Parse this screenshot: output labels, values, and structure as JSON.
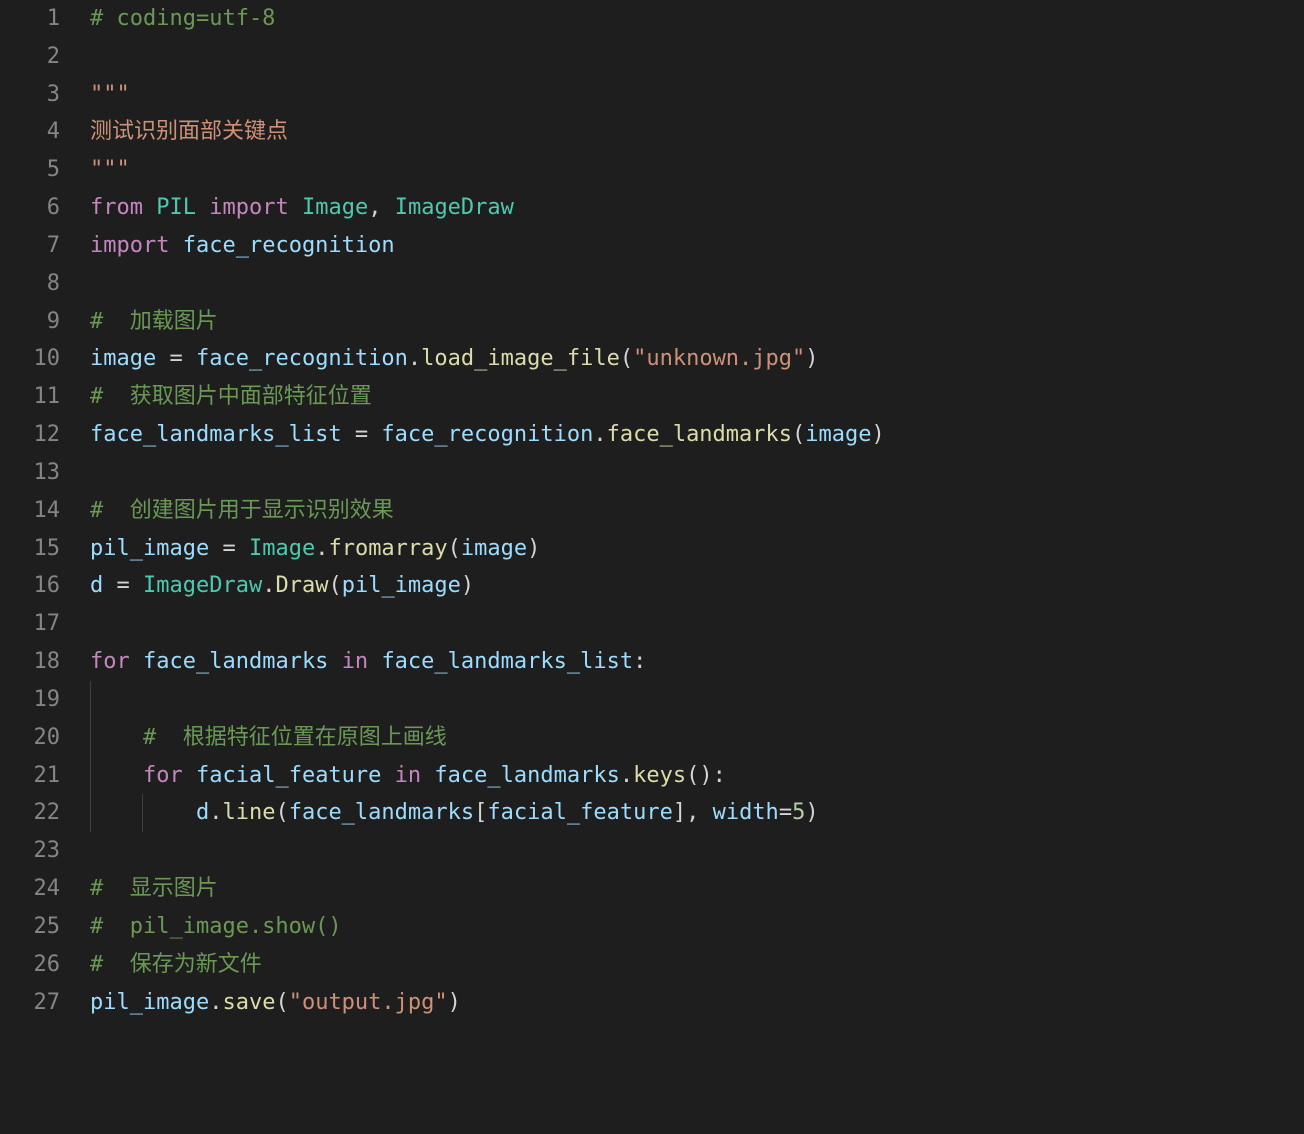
{
  "lines": [
    {
      "num": "1",
      "tokens": [
        {
          "t": "# coding=utf-8",
          "c": "comment"
        }
      ]
    },
    {
      "num": "2",
      "tokens": []
    },
    {
      "num": "3",
      "tokens": [
        {
          "t": "\"\"\"",
          "c": "docstring"
        }
      ]
    },
    {
      "num": "4",
      "tokens": [
        {
          "t": "测试识别面部关键点",
          "c": "docstring-text"
        }
      ]
    },
    {
      "num": "5",
      "tokens": [
        {
          "t": "\"\"\"",
          "c": "docstring"
        }
      ]
    },
    {
      "num": "6",
      "tokens": [
        {
          "t": "from",
          "c": "keyword"
        },
        {
          "t": " ",
          "c": ""
        },
        {
          "t": "PIL",
          "c": "class-name"
        },
        {
          "t": " ",
          "c": ""
        },
        {
          "t": "import",
          "c": "keyword"
        },
        {
          "t": " ",
          "c": ""
        },
        {
          "t": "Image",
          "c": "class-name"
        },
        {
          "t": ", ",
          "c": "punctuation"
        },
        {
          "t": "ImageDraw",
          "c": "class-name"
        }
      ]
    },
    {
      "num": "7",
      "tokens": [
        {
          "t": "import",
          "c": "keyword"
        },
        {
          "t": " ",
          "c": ""
        },
        {
          "t": "face_recognition",
          "c": "variable"
        }
      ]
    },
    {
      "num": "8",
      "tokens": []
    },
    {
      "num": "9",
      "tokens": [
        {
          "t": "#  加载图片",
          "c": "comment"
        }
      ]
    },
    {
      "num": "10",
      "tokens": [
        {
          "t": "image",
          "c": "variable"
        },
        {
          "t": " = ",
          "c": "punctuation"
        },
        {
          "t": "face_recognition",
          "c": "variable"
        },
        {
          "t": ".",
          "c": "punctuation"
        },
        {
          "t": "load_image_file",
          "c": "function"
        },
        {
          "t": "(",
          "c": "punctuation"
        },
        {
          "t": "\"unknown.jpg\"",
          "c": "string"
        },
        {
          "t": ")",
          "c": "punctuation"
        }
      ]
    },
    {
      "num": "11",
      "tokens": [
        {
          "t": "#  获取图片中面部特征位置",
          "c": "comment"
        }
      ]
    },
    {
      "num": "12",
      "tokens": [
        {
          "t": "face_landmarks_list",
          "c": "variable"
        },
        {
          "t": " = ",
          "c": "punctuation"
        },
        {
          "t": "face_recognition",
          "c": "variable"
        },
        {
          "t": ".",
          "c": "punctuation"
        },
        {
          "t": "face_landmarks",
          "c": "function"
        },
        {
          "t": "(",
          "c": "punctuation"
        },
        {
          "t": "image",
          "c": "variable"
        },
        {
          "t": ")",
          "c": "punctuation"
        }
      ]
    },
    {
      "num": "13",
      "tokens": []
    },
    {
      "num": "14",
      "tokens": [
        {
          "t": "#  创建图片用于显示识别效果",
          "c": "comment"
        }
      ]
    },
    {
      "num": "15",
      "tokens": [
        {
          "t": "pil_image",
          "c": "variable"
        },
        {
          "t": " = ",
          "c": "punctuation"
        },
        {
          "t": "Image",
          "c": "class-name"
        },
        {
          "t": ".",
          "c": "punctuation"
        },
        {
          "t": "fromarray",
          "c": "function"
        },
        {
          "t": "(",
          "c": "punctuation"
        },
        {
          "t": "image",
          "c": "variable"
        },
        {
          "t": ")",
          "c": "punctuation"
        }
      ]
    },
    {
      "num": "16",
      "tokens": [
        {
          "t": "d",
          "c": "variable"
        },
        {
          "t": " = ",
          "c": "punctuation"
        },
        {
          "t": "ImageDraw",
          "c": "class-name"
        },
        {
          "t": ".",
          "c": "punctuation"
        },
        {
          "t": "Draw",
          "c": "function"
        },
        {
          "t": "(",
          "c": "punctuation"
        },
        {
          "t": "pil_image",
          "c": "variable"
        },
        {
          "t": ")",
          "c": "punctuation"
        }
      ]
    },
    {
      "num": "17",
      "tokens": []
    },
    {
      "num": "18",
      "tokens": [
        {
          "t": "for",
          "c": "keyword"
        },
        {
          "t": " ",
          "c": ""
        },
        {
          "t": "face_landmarks",
          "c": "variable"
        },
        {
          "t": " ",
          "c": ""
        },
        {
          "t": "in",
          "c": "keyword"
        },
        {
          "t": " ",
          "c": ""
        },
        {
          "t": "face_landmarks_list",
          "c": "variable"
        },
        {
          "t": ":",
          "c": "punctuation"
        }
      ]
    },
    {
      "num": "19",
      "tokens": [],
      "indent": 1
    },
    {
      "num": "20",
      "tokens": [
        {
          "t": "    ",
          "c": ""
        },
        {
          "t": "#  根据特征位置在原图上画线",
          "c": "comment"
        }
      ],
      "indent": 1
    },
    {
      "num": "21",
      "tokens": [
        {
          "t": "    ",
          "c": ""
        },
        {
          "t": "for",
          "c": "keyword"
        },
        {
          "t": " ",
          "c": ""
        },
        {
          "t": "facial_feature",
          "c": "variable"
        },
        {
          "t": " ",
          "c": ""
        },
        {
          "t": "in",
          "c": "keyword"
        },
        {
          "t": " ",
          "c": ""
        },
        {
          "t": "face_landmarks",
          "c": "variable"
        },
        {
          "t": ".",
          "c": "punctuation"
        },
        {
          "t": "keys",
          "c": "function"
        },
        {
          "t": "():",
          "c": "punctuation"
        }
      ],
      "indent": 1
    },
    {
      "num": "22",
      "tokens": [
        {
          "t": "        ",
          "c": ""
        },
        {
          "t": "d",
          "c": "variable"
        },
        {
          "t": ".",
          "c": "punctuation"
        },
        {
          "t": "line",
          "c": "function"
        },
        {
          "t": "(",
          "c": "punctuation"
        },
        {
          "t": "face_landmarks",
          "c": "variable"
        },
        {
          "t": "[",
          "c": "punctuation"
        },
        {
          "t": "facial_feature",
          "c": "variable"
        },
        {
          "t": "], ",
          "c": "punctuation"
        },
        {
          "t": "width",
          "c": "variable"
        },
        {
          "t": "=",
          "c": "punctuation"
        },
        {
          "t": "5",
          "c": "number"
        },
        {
          "t": ")",
          "c": "punctuation"
        }
      ],
      "indent": 2
    },
    {
      "num": "23",
      "tokens": []
    },
    {
      "num": "24",
      "tokens": [
        {
          "t": "#  显示图片",
          "c": "comment"
        }
      ]
    },
    {
      "num": "25",
      "tokens": [
        {
          "t": "#  pil_image.show()",
          "c": "comment"
        }
      ]
    },
    {
      "num": "26",
      "tokens": [
        {
          "t": "#  保存为新文件",
          "c": "comment"
        }
      ]
    },
    {
      "num": "27",
      "tokens": [
        {
          "t": "pil_image",
          "c": "variable"
        },
        {
          "t": ".",
          "c": "punctuation"
        },
        {
          "t": "save",
          "c": "function"
        },
        {
          "t": "(",
          "c": "punctuation"
        },
        {
          "t": "\"output.jpg\"",
          "c": "string"
        },
        {
          "t": ")",
          "c": "punctuation"
        }
      ]
    }
  ]
}
